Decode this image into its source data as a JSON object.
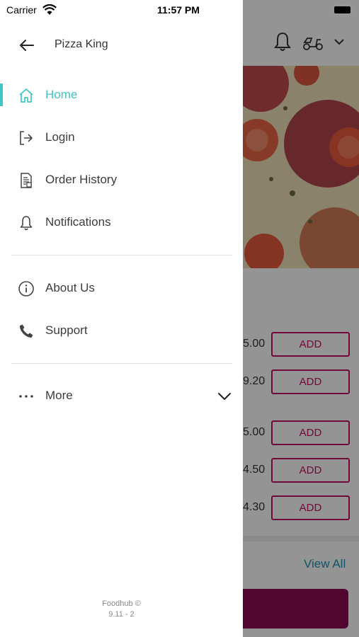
{
  "status_bar": {
    "carrier": "Carrier",
    "time": "11:57 PM"
  },
  "drawer": {
    "store_name": "Pizza King",
    "menu": [
      {
        "label": "Home",
        "icon": "home-icon",
        "active": true
      },
      {
        "label": "Login",
        "icon": "login-icon",
        "active": false
      },
      {
        "label": "Order History",
        "icon": "order-history-icon",
        "active": false
      },
      {
        "label": "Notifications",
        "icon": "bell-icon",
        "active": false
      },
      {
        "label": "About Us",
        "icon": "info-icon",
        "active": false
      },
      {
        "label": "Support",
        "icon": "phone-icon",
        "active": false
      },
      {
        "label": "More",
        "icon": "more-dots-icon",
        "active": false
      }
    ],
    "footer": {
      "brand": "Foodhub ©",
      "version": "9.11 - 2"
    }
  },
  "background": {
    "items": [
      {
        "price": "5.00",
        "button": "ADD"
      },
      {
        "price": "9.20",
        "button": "ADD"
      },
      {
        "price": "5.00",
        "button": "ADD"
      },
      {
        "price": "4.50",
        "button": "ADD"
      },
      {
        "price": "4.30",
        "button": "ADD"
      }
    ],
    "view_all": "View All"
  },
  "colors": {
    "accent": "#3ec6c4",
    "brand": "#c2105f",
    "link": "#1f8fb0"
  }
}
